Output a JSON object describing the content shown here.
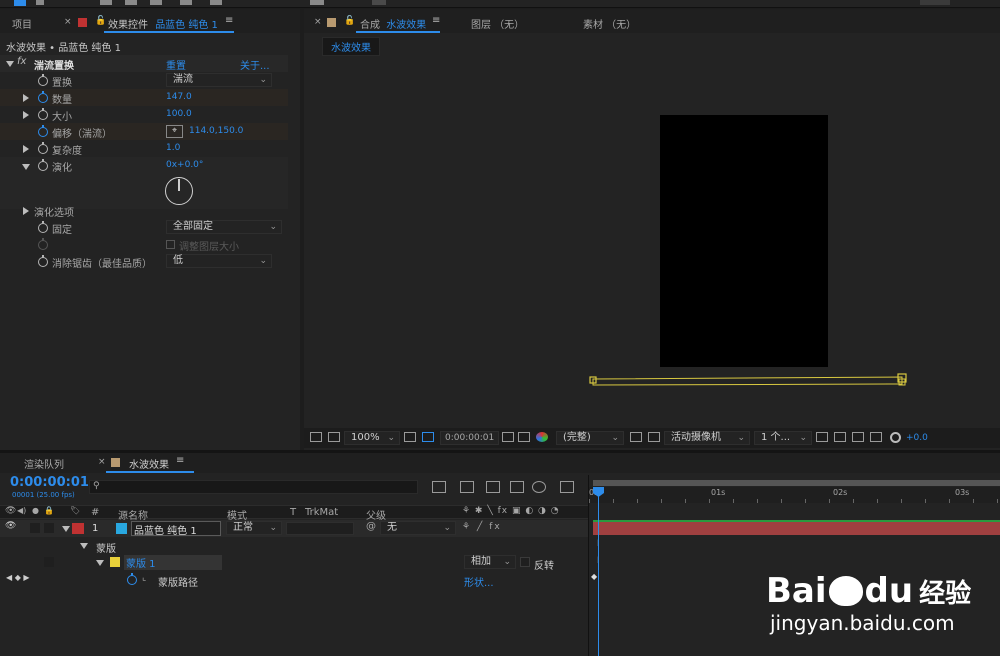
{
  "effects_panel": {
    "tab_project": "项目",
    "tab_effect_controls": "效果控件",
    "tab_layer_name": "品蓝色 纯色 1",
    "breadcrumb": "水波效果 • 品蓝色 纯色 1",
    "effect_name": "湍流置换",
    "reset": "重置",
    "about": "关于...",
    "properties": [
      {
        "label": "置换",
        "value": "湍流"
      },
      {
        "label": "数量",
        "value": "147.0"
      },
      {
        "label": "大小",
        "value": "100.0"
      },
      {
        "label": "偏移（湍流）",
        "value": "114.0,150.0"
      },
      {
        "label": "复杂度",
        "value": "1.0"
      },
      {
        "label": "演化",
        "value": "0x+0.0°"
      },
      {
        "label": "演化选项",
        "value": ""
      },
      {
        "label": "固定",
        "value": "全部固定"
      },
      {
        "label": "",
        "value": "调整图层大小"
      },
      {
        "label": "消除锯齿（最佳品质）",
        "value": "低"
      }
    ]
  },
  "comp_panel": {
    "tab_comp_prefix": "合成",
    "tab_comp_name": "水波效果",
    "tab_layer": "图层 （无）",
    "tab_footage": "素材 （无）",
    "comp_chip": "水波效果",
    "zoom": "100%",
    "timecode": "0:00:00:01",
    "resolution": "(完整)",
    "camera": "活动摄像机",
    "views": "1 个...",
    "exposure": "+0.0"
  },
  "timeline": {
    "tab_render_queue": "渲染队列",
    "tab_comp": "水波效果",
    "timecode": "0:00:00:01",
    "frame_info": "00001 (25.00 fps)",
    "search_placeholder": "",
    "col_hash": "#",
    "col_source_name": "源名称",
    "col_mode": "模式",
    "col_t": "T",
    "col_trkmat": "TrkMat",
    "col_parent": "父级",
    "layer_number": "1",
    "layer_name": "品蓝色 纯色 1",
    "layer_mode": "正常",
    "layer_parent": "无",
    "masks_group": "蒙版",
    "mask_name": "蒙版 1",
    "mask_mode": "相加",
    "mask_invert": "反转",
    "mask_path": "蒙版路径",
    "mask_shape": "形状...",
    "ruler": [
      "0s",
      "01s",
      "02s",
      "03s"
    ]
  },
  "watermark": {
    "brand_left": "Bai",
    "brand_right": "du",
    "brand_cn": "经验",
    "url": "jingyan.baidu.com"
  },
  "colors": {
    "accent": "#2d8ceb",
    "layer_red": "#c03232",
    "layer_cyan": "#29a8e0",
    "mask_yellow": "#e8d03a",
    "track_bar": "#a04040"
  }
}
